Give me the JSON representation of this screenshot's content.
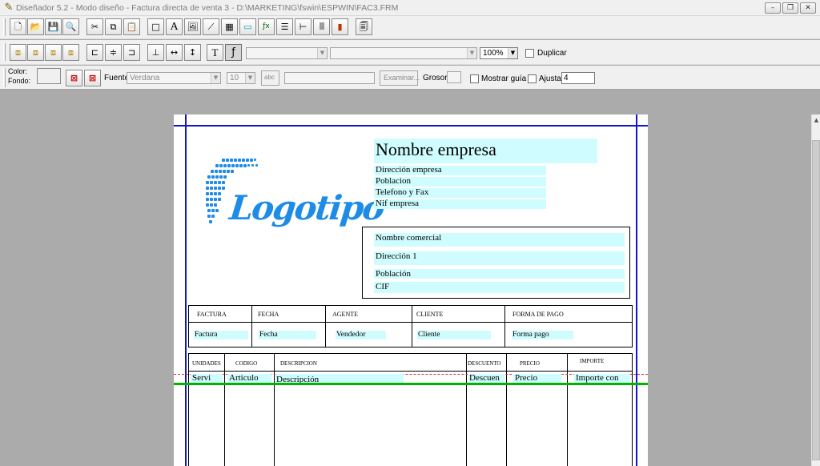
{
  "window": {
    "title": "Diseñador 5.2 - Modo diseño - Factura directa de venta 3 - D:\\MARKETING\\fswin\\ESPWIN\\FAC3.FRM",
    "minimize_glyph": "–",
    "maximize_glyph": "❐",
    "close_glyph": "✕"
  },
  "toolbar1": {
    "buttons": [
      {
        "name": "new-document",
        "glyph": "🗋"
      },
      {
        "name": "open-folder",
        "glyph": "📂"
      },
      {
        "name": "save-disk",
        "glyph": "💾"
      },
      {
        "name": "print-preview",
        "glyph": "🔍"
      },
      {
        "name": "cut-scissors",
        "glyph": "✂"
      },
      {
        "name": "copy",
        "glyph": "⧉"
      },
      {
        "name": "paste-clipboard",
        "glyph": "📋"
      },
      {
        "name": "rectangle",
        "glyph": "□"
      },
      {
        "name": "text",
        "glyph": "A"
      },
      {
        "name": "image",
        "glyph": "🖼"
      },
      {
        "name": "line",
        "glyph": "⟋"
      },
      {
        "name": "grid-table",
        "glyph": "▦"
      },
      {
        "name": "field",
        "glyph": "▭"
      },
      {
        "name": "formula",
        "glyph": "ƒx"
      },
      {
        "name": "list",
        "glyph": "☰"
      },
      {
        "name": "tree",
        "glyph": "⊢"
      },
      {
        "name": "barcode",
        "glyph": "|||"
      },
      {
        "name": "bar-chart",
        "glyph": "▮"
      },
      {
        "name": "page-layout",
        "glyph": "🗐"
      }
    ]
  },
  "toolbar2": {
    "buttons": [
      {
        "name": "bring-front",
        "glyph": "⧈"
      },
      {
        "name": "send-back",
        "glyph": "⧈"
      },
      {
        "name": "bring-forward",
        "glyph": "⧈"
      },
      {
        "name": "send-backward",
        "glyph": "⧈"
      },
      {
        "name": "align-left",
        "glyph": "⊏"
      },
      {
        "name": "align-center",
        "glyph": "≑"
      },
      {
        "name": "align-right",
        "glyph": "⊐"
      },
      {
        "name": "align-bottom",
        "glyph": "⊥"
      },
      {
        "name": "distribute-horizontal",
        "glyph": "↔"
      },
      {
        "name": "distribute-vertical",
        "glyph": "↕"
      },
      {
        "name": "text-tool",
        "glyph": "T"
      },
      {
        "name": "field-formula",
        "glyph": "ƒ"
      }
    ],
    "combo1": "",
    "combo2": "",
    "zoom": "100%",
    "duplicar_label": "Duplicar"
  },
  "toolbar3": {
    "color_label": "Color:",
    "fondo_label": "Fondo:",
    "fuente_label": "Fuente:",
    "font_value": "Verdana",
    "size_value": "10",
    "abc_label": "abc",
    "examinar_label": "Examinar...",
    "grosor_label": "Grosor:",
    "mostrar_guia_label": "Mostrar guía",
    "ajustar_label": "Ajustar",
    "ajustar_value": "4"
  },
  "document": {
    "logo_text": "Logotipo",
    "company": {
      "name": "Nombre empresa",
      "address": "Dirección empresa",
      "city": "Poblacion",
      "phone": "Telefono y Fax",
      "nif": "Nif empresa"
    },
    "client": {
      "name": "Nombre comercial",
      "address": "Dirección 1",
      "city": "Población",
      "cif": "CIF"
    },
    "header_table": {
      "columns": [
        "FACTURA",
        "FECHA",
        "AGENTE",
        "CLIENTE",
        "FORMA DE PAGO"
      ],
      "values": [
        "Factura",
        "Fecha",
        "Vendedor",
        "Cliente",
        "Forma pago"
      ]
    },
    "lines_table": {
      "columns": [
        "UNIDADES",
        "CODIGO",
        "DESCRIPCION",
        "DESCUENTO",
        "PRECIO",
        "IMPORTE"
      ],
      "values": [
        "Servi",
        "Articulo",
        "Descripción",
        "Descuen",
        "Precio",
        "Importe con"
      ]
    }
  },
  "colors": {
    "field_highlight": "#cffcff",
    "guide_blue": "#1414c8",
    "band_green": "#00b400",
    "band_red": "#e23030",
    "logo_blue": "#1e8ce6"
  }
}
